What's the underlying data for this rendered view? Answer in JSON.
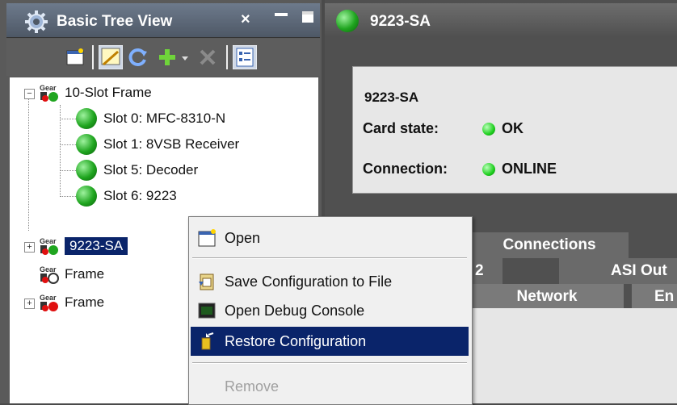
{
  "left_panel": {
    "title": "Basic Tree View",
    "close_glyph": "×",
    "toolbar_icons": [
      "new-icon",
      "wizard-icon",
      "refresh-icon",
      "add-icon",
      "dropdown-icon",
      "delete-icon",
      "properties-icon"
    ]
  },
  "tree": {
    "frame1": {
      "label": "10-Slot Frame",
      "slots": [
        "Slot 0: MFC-8310-N",
        "Slot 1: 8VSB Receiver",
        "Slot 5: Decoder",
        "Slot 6: 9223"
      ]
    },
    "items": [
      {
        "label": "9223-SA",
        "selected": true,
        "status_color": "#1fa51f"
      },
      {
        "label": "Frame",
        "selected": false,
        "status_color": "#ffffff"
      },
      {
        "label": "Frame",
        "selected": false,
        "status_color": "#e01010"
      }
    ]
  },
  "right_panel": {
    "title": "9223-SA",
    "device_name": "9223-SA",
    "card_state_label": "Card state:",
    "card_state_value": "OK",
    "connection_label": "Connection:",
    "connection_value": "ONLINE",
    "tabs": {
      "connections": "Connections",
      "row2_left": "2",
      "asi_out": "ASI Out",
      "network": "Network",
      "en": "En"
    }
  },
  "context_menu": {
    "items": [
      {
        "label": "Open",
        "icon": "open-icon",
        "state": "normal"
      },
      {
        "label": "Save Configuration to File",
        "icon": "save-file-icon",
        "state": "normal"
      },
      {
        "label": "Open Debug Console",
        "icon": "console-icon",
        "state": "normal"
      },
      {
        "label": "Restore Configuration",
        "icon": "restore-icon",
        "state": "highlighted"
      },
      {
        "label": "Remove",
        "icon": "",
        "state": "disabled"
      }
    ]
  },
  "colors": {
    "selection": "#0a246a",
    "status_ok": "#1fd01f"
  }
}
